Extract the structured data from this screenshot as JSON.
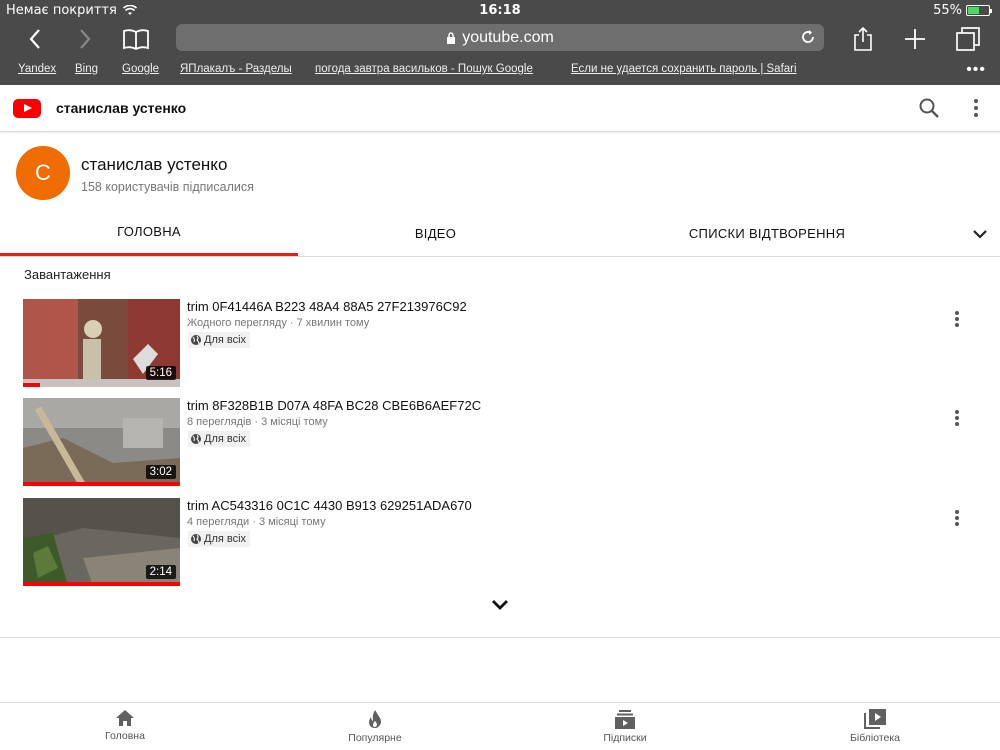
{
  "status_bar": {
    "carrier": "Немає покриття",
    "time": "16:18",
    "battery_text": "55%",
    "battery_level": 0.55
  },
  "browser": {
    "url": "youtube.com",
    "bookmarks": [
      "Yandex",
      "Bing",
      "Google",
      "ЯПлакалъ - Разделы",
      "погода завтра васильков - Пошук Google",
      "Если не удается сохранить пароль | Safari"
    ],
    "more": "•••"
  },
  "header": {
    "title": "станислав устенко"
  },
  "channel": {
    "avatar_letter": "С",
    "name": "станислав устенко",
    "subscribers": "158 користувачів підписалися"
  },
  "tabs": [
    {
      "label": "ГОЛОВНА",
      "active": true
    },
    {
      "label": "ВІДЕО",
      "active": false
    },
    {
      "label": "СПИСКИ ВІДТВОРЕННЯ",
      "active": false
    }
  ],
  "uploads": {
    "title": "Завантаження",
    "videos": [
      {
        "title": "trim 0F41446A B223 48A4 88A5 27F213976C92",
        "meta": "Жодного перегляду · 7 хвилин тому",
        "privacy": "Для всіх",
        "duration": "5:16",
        "watched": 0.11
      },
      {
        "title": "trim 8F328B1B D07A 48FA BC28 CBE6B6AEF72C",
        "meta": "8 переглядів · 3 місяці тому",
        "privacy": "Для всіх",
        "duration": "3:02",
        "watched": 1.0
      },
      {
        "title": "trim AC543316 0C1C 4430 B913 629251ADA670",
        "meta": "4 перегляди · 3 місяці тому",
        "privacy": "Для всіх",
        "duration": "2:14",
        "watched": 1.0
      }
    ]
  },
  "bottom_nav": [
    {
      "label": "Головна",
      "icon": "home-icon"
    },
    {
      "label": "Популярне",
      "icon": "fire-icon"
    },
    {
      "label": "Підписки",
      "icon": "subscriptions-icon"
    },
    {
      "label": "Бібліотека",
      "icon": "library-icon"
    }
  ],
  "colors": {
    "accent": "#ff0000",
    "tab_indicator": "#e62117",
    "avatar": "#ef6c00",
    "browser_chrome": "#4a4a4a"
  }
}
